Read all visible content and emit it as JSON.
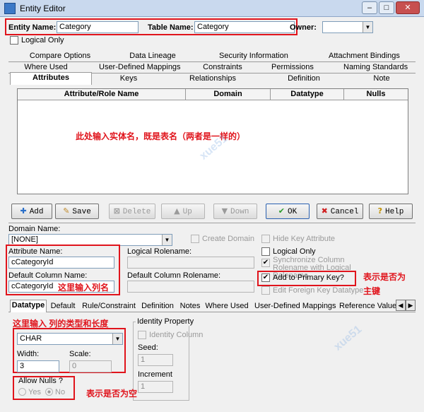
{
  "window": {
    "title": "Entity Editor",
    "min": "–",
    "max": "□",
    "close": "✕"
  },
  "header": {
    "entity_name_label": "Entity Name:",
    "entity_name_value": "Category",
    "table_name_label": "Table Name:",
    "table_name_value": "Category",
    "owner_label": "Owner:",
    "owner_value": "",
    "logical_only_label": "Logical Only"
  },
  "tabs_row1": [
    "Compare Options",
    "Data Lineage",
    "Security Information",
    "Attachment Bindings"
  ],
  "tabs_row2": [
    "Where Used",
    "User-Defined Mappings",
    "Constraints",
    "Permissions",
    "Naming Standards"
  ],
  "tabs_row3": [
    "Attributes",
    "Keys",
    "Relationships",
    "Definition",
    "Note"
  ],
  "grid": {
    "columns": [
      "Attribute/Role Name",
      "Domain",
      "Datatype",
      "Nulls"
    ],
    "rows": [],
    "annotation": "此处输入实体名，既是表名（两者是一样的）"
  },
  "buttons": {
    "add": "Add",
    "save": "Save",
    "delete": "Delete",
    "up": "Up",
    "down": "Down",
    "ok": "OK",
    "cancel": "Cancel",
    "help": "Help"
  },
  "domain": {
    "label": "Domain Name:",
    "value": "[NONE]",
    "create_domain": "Create Domain",
    "hide_key_attr": "Hide Key Attribute"
  },
  "attribute": {
    "attr_name_label": "Attribute Name:",
    "attr_name_value": "cCategoryId",
    "logical_rolename_label": "Logical Rolename:",
    "default_col_label": "Default Column Name:",
    "default_col_value": "cCategoryId",
    "default_col_rolename_label": "Default Column Rolename:",
    "logical_only": "Logical Only",
    "sync_column": "Synchronize Column Rolename with Logical Rolename",
    "add_pk": "Add to Primary Key?",
    "edit_fk": "Edit Foreign Key Datatype",
    "annotation_colname": "这里输入列名",
    "annotation_pk_1": "表示是否为",
    "annotation_pk_2": "主键"
  },
  "tabs_bottom": [
    "Datatype",
    "Default",
    "Rule/Constraint",
    "Definition",
    "Notes",
    "Where Used",
    "User-Defined Mappings",
    "Reference Value"
  ],
  "datatype": {
    "annotation_type": "这里输入 列的类型和长度",
    "type_value": "CHAR",
    "width_label": "Width:",
    "width_value": "3",
    "scale_label": "Scale:",
    "scale_value": "0",
    "identity_title": "Identity Property",
    "identity_column": "Identity Column",
    "seed_label": "Seed:",
    "seed_value": "1",
    "increment_label": "Increment",
    "increment_value": "1",
    "allow_nulls_label": "Allow Nulls ?",
    "yes": "Yes",
    "no": "No",
    "annotation_null": "表示是否为空"
  },
  "colors": {
    "annotation_red": "#e0141c",
    "title_bar": "#c9d9ee"
  }
}
